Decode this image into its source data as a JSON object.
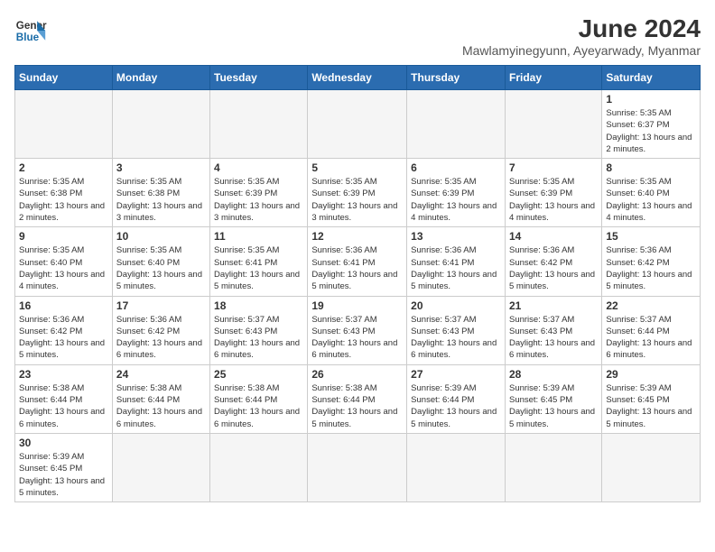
{
  "header": {
    "logo_general": "General",
    "logo_blue": "Blue",
    "month_year": "June 2024",
    "location": "Mawlamyinegyunn, Ayeyarwady, Myanmar"
  },
  "weekdays": [
    "Sunday",
    "Monday",
    "Tuesday",
    "Wednesday",
    "Thursday",
    "Friday",
    "Saturday"
  ],
  "weeks": [
    [
      {
        "day": "",
        "info": ""
      },
      {
        "day": "",
        "info": ""
      },
      {
        "day": "",
        "info": ""
      },
      {
        "day": "",
        "info": ""
      },
      {
        "day": "",
        "info": ""
      },
      {
        "day": "",
        "info": ""
      },
      {
        "day": "1",
        "info": "Sunrise: 5:35 AM\nSunset: 6:37 PM\nDaylight: 13 hours and 2 minutes."
      }
    ],
    [
      {
        "day": "2",
        "info": "Sunrise: 5:35 AM\nSunset: 6:38 PM\nDaylight: 13 hours and 2 minutes."
      },
      {
        "day": "3",
        "info": "Sunrise: 5:35 AM\nSunset: 6:38 PM\nDaylight: 13 hours and 3 minutes."
      },
      {
        "day": "4",
        "info": "Sunrise: 5:35 AM\nSunset: 6:39 PM\nDaylight: 13 hours and 3 minutes."
      },
      {
        "day": "5",
        "info": "Sunrise: 5:35 AM\nSunset: 6:39 PM\nDaylight: 13 hours and 3 minutes."
      },
      {
        "day": "6",
        "info": "Sunrise: 5:35 AM\nSunset: 6:39 PM\nDaylight: 13 hours and 4 minutes."
      },
      {
        "day": "7",
        "info": "Sunrise: 5:35 AM\nSunset: 6:39 PM\nDaylight: 13 hours and 4 minutes."
      },
      {
        "day": "8",
        "info": "Sunrise: 5:35 AM\nSunset: 6:40 PM\nDaylight: 13 hours and 4 minutes."
      }
    ],
    [
      {
        "day": "9",
        "info": "Sunrise: 5:35 AM\nSunset: 6:40 PM\nDaylight: 13 hours and 4 minutes."
      },
      {
        "day": "10",
        "info": "Sunrise: 5:35 AM\nSunset: 6:40 PM\nDaylight: 13 hours and 5 minutes."
      },
      {
        "day": "11",
        "info": "Sunrise: 5:35 AM\nSunset: 6:41 PM\nDaylight: 13 hours and 5 minutes."
      },
      {
        "day": "12",
        "info": "Sunrise: 5:36 AM\nSunset: 6:41 PM\nDaylight: 13 hours and 5 minutes."
      },
      {
        "day": "13",
        "info": "Sunrise: 5:36 AM\nSunset: 6:41 PM\nDaylight: 13 hours and 5 minutes."
      },
      {
        "day": "14",
        "info": "Sunrise: 5:36 AM\nSunset: 6:42 PM\nDaylight: 13 hours and 5 minutes."
      },
      {
        "day": "15",
        "info": "Sunrise: 5:36 AM\nSunset: 6:42 PM\nDaylight: 13 hours and 5 minutes."
      }
    ],
    [
      {
        "day": "16",
        "info": "Sunrise: 5:36 AM\nSunset: 6:42 PM\nDaylight: 13 hours and 5 minutes."
      },
      {
        "day": "17",
        "info": "Sunrise: 5:36 AM\nSunset: 6:42 PM\nDaylight: 13 hours and 6 minutes."
      },
      {
        "day": "18",
        "info": "Sunrise: 5:37 AM\nSunset: 6:43 PM\nDaylight: 13 hours and 6 minutes."
      },
      {
        "day": "19",
        "info": "Sunrise: 5:37 AM\nSunset: 6:43 PM\nDaylight: 13 hours and 6 minutes."
      },
      {
        "day": "20",
        "info": "Sunrise: 5:37 AM\nSunset: 6:43 PM\nDaylight: 13 hours and 6 minutes."
      },
      {
        "day": "21",
        "info": "Sunrise: 5:37 AM\nSunset: 6:43 PM\nDaylight: 13 hours and 6 minutes."
      },
      {
        "day": "22",
        "info": "Sunrise: 5:37 AM\nSunset: 6:44 PM\nDaylight: 13 hours and 6 minutes."
      }
    ],
    [
      {
        "day": "23",
        "info": "Sunrise: 5:38 AM\nSunset: 6:44 PM\nDaylight: 13 hours and 6 minutes."
      },
      {
        "day": "24",
        "info": "Sunrise: 5:38 AM\nSunset: 6:44 PM\nDaylight: 13 hours and 6 minutes."
      },
      {
        "day": "25",
        "info": "Sunrise: 5:38 AM\nSunset: 6:44 PM\nDaylight: 13 hours and 6 minutes."
      },
      {
        "day": "26",
        "info": "Sunrise: 5:38 AM\nSunset: 6:44 PM\nDaylight: 13 hours and 5 minutes."
      },
      {
        "day": "27",
        "info": "Sunrise: 5:39 AM\nSunset: 6:44 PM\nDaylight: 13 hours and 5 minutes."
      },
      {
        "day": "28",
        "info": "Sunrise: 5:39 AM\nSunset: 6:45 PM\nDaylight: 13 hours and 5 minutes."
      },
      {
        "day": "29",
        "info": "Sunrise: 5:39 AM\nSunset: 6:45 PM\nDaylight: 13 hours and 5 minutes."
      }
    ],
    [
      {
        "day": "30",
        "info": "Sunrise: 5:39 AM\nSunset: 6:45 PM\nDaylight: 13 hours and 5 minutes."
      },
      {
        "day": "",
        "info": ""
      },
      {
        "day": "",
        "info": ""
      },
      {
        "day": "",
        "info": ""
      },
      {
        "day": "",
        "info": ""
      },
      {
        "day": "",
        "info": ""
      },
      {
        "day": "",
        "info": ""
      }
    ]
  ]
}
